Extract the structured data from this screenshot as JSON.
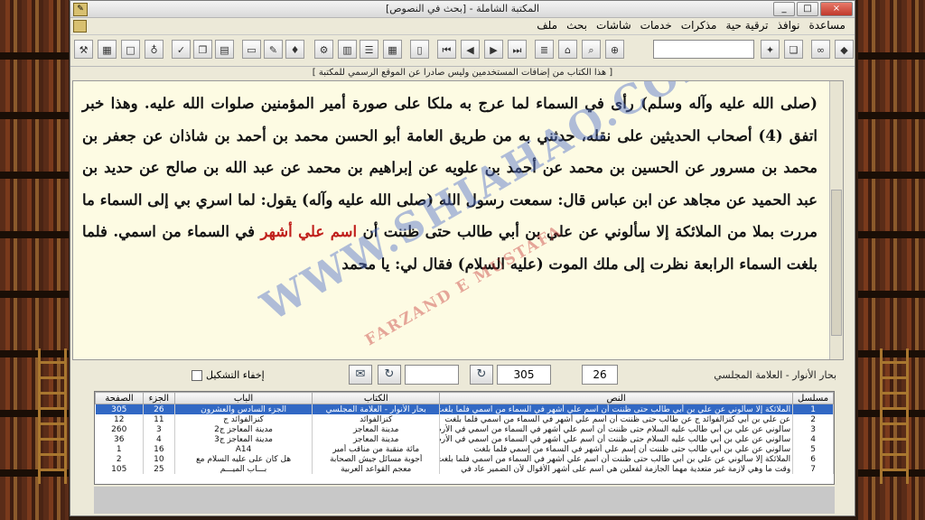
{
  "window": {
    "title": "المكتبة الشاملة - [بحث في النصوص]",
    "min": "_",
    "max": "□",
    "close": "×"
  },
  "menu": [
    "ملف",
    "بحث",
    "شاشات",
    "خدمات",
    "مذكرات",
    "ترقية حية",
    "نوافذ",
    "مساعدة"
  ],
  "notice": "[ هذا الكتاب من إضافات المستخدمين وليس صادرا عن الموقع الرسمي للمكتبة ]",
  "reader": {
    "part1": "(صلى الله عليه وآله وسلم) رأى في السماء لما عرج به ملكا على صورة أمير المؤمنين صلوات الله عليه. وهذا خبر اتفق (4) أصحاب الحديثين على نقله، حدثني به من طريق العامة أبو الحسن محمد بن أحمد بن شاذان عن جعفر بن محمد بن مسرور عن الحسين بن محمد عن أحمد بن علويه عن إبراهيم بن محمد عن عبد الله بن صالح عن حديد بن عبد الحميد عن مجاهد عن ابن عباس قال: سمعت رسول الله (صلى الله عليه وآله) يقول: لما اسري بي إلى السماء ما مررت بملا من الملائكة إلا سألوني عن علي بن أبي طالب حتى ظننت أن ",
    "highlight": "اسم علي أشهر",
    "part2": " في السماء من اسمي. فلما بلغت السماء الرابعة نظرت إلى ملك الموت (عليه السلام) فقال لي: يا محمد"
  },
  "watermark": {
    "main": "WWW.SHIAHAQ.COM",
    "sub": "FARZAND E MUSTAFA"
  },
  "nav": {
    "book": "بحار الأنوار - العلامة المجلسي",
    "part": "26",
    "page": "305",
    "hide_label": "إخفاء التشكيل"
  },
  "table": {
    "headers": [
      "مسلسل",
      "النص",
      "الكتاب",
      "الباب",
      "الجزء",
      "الصفحة"
    ],
    "rows": [
      [
        "1",
        "الملائكة إلا سألوني عن علي بن أبي طالب حتى ظننت أن اسم علي أشهر في السماء من اسمي فلما بلغت",
        "بحار الأنوار - العلامة المجلسي",
        "الجزء السادس والعشرون",
        "26",
        "305"
      ],
      [
        "2",
        "عن علي بن أبي كنزالفوائد ج عن طالب حتى ظننت أن اسم علي أشهر في السماء من اسمي فلما بلغت",
        "كنزالفوائد",
        "كنزالفوائد ج",
        "11",
        "12"
      ],
      [
        "3",
        "سالوني عن علي بن أبي طالب عليه السلام حتى ظننت أن اسم علي أشهر في السماء من اسمي في الأرض",
        "مدينة المعاجز",
        "مدينة المعاجز ج2",
        "3",
        "260"
      ],
      [
        "4",
        "سالوني عن علي بن أبي طالب عليه السلام حتى ظننت أن اسم علي أشهر في السماء من اسمي في الأرض",
        "مدينة المعاجز",
        "مدينة المعاجز ج3",
        "4",
        "36"
      ],
      [
        "5",
        "سالوني عن علي بن أبي طالب حتى ظننت أن إسم علي أشهر في السماء من إسمي فلما بلغت",
        "مائة منقبة من مناقب أمير",
        "A14",
        "16",
        "1"
      ],
      [
        "6",
        "الملائكة إلا سألوني عن علي بن أبي طالب حتى ظننت أن اسم علي أشهر في السماء من اسمي فلما بلغت",
        "أجوبة مسائل جيش الصحابة",
        "هل كان على عليه السلام مع",
        "10",
        "2"
      ],
      [
        "7",
        "وقت ما وهي لازمة غير متعدية مهما الجازمة لفعلين هي اسم على أشهر الأقوال لأن الضمير عاد في",
        "معجم القواعد العربية",
        "بـــاب الميـــم",
        "25",
        "105"
      ]
    ]
  }
}
